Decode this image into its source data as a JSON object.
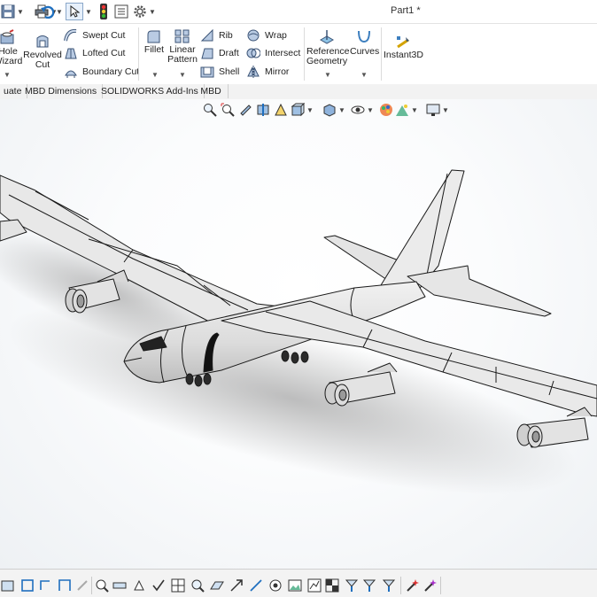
{
  "window": {
    "title": "Part1 *"
  },
  "ribbon": {
    "hole_wizard": "Hole\nWizard",
    "revolved_cut": "Revolved\nCut",
    "swept_cut": "Swept Cut",
    "lofted_cut": "Lofted Cut",
    "boundary_cut": "Boundary Cut",
    "fillet": "Fillet",
    "linear_pattern": "Linear\nPattern",
    "rib": "Rib",
    "draft": "Draft",
    "shell": "Shell",
    "wrap": "Wrap",
    "intersect": "Intersect",
    "mirror": "Mirror",
    "reference_geometry": "Reference\nGeometry",
    "curves": "Curves",
    "instant3d": "Instant3D"
  },
  "tabs": [
    "uate",
    "MBD Dimensions",
    "SOLIDWORKS Add-Ins",
    "MBD"
  ],
  "colors": {
    "accent": "#1f6fbf",
    "model_fill": "#e6e6e6",
    "model_edge": "#1a1a1a"
  }
}
